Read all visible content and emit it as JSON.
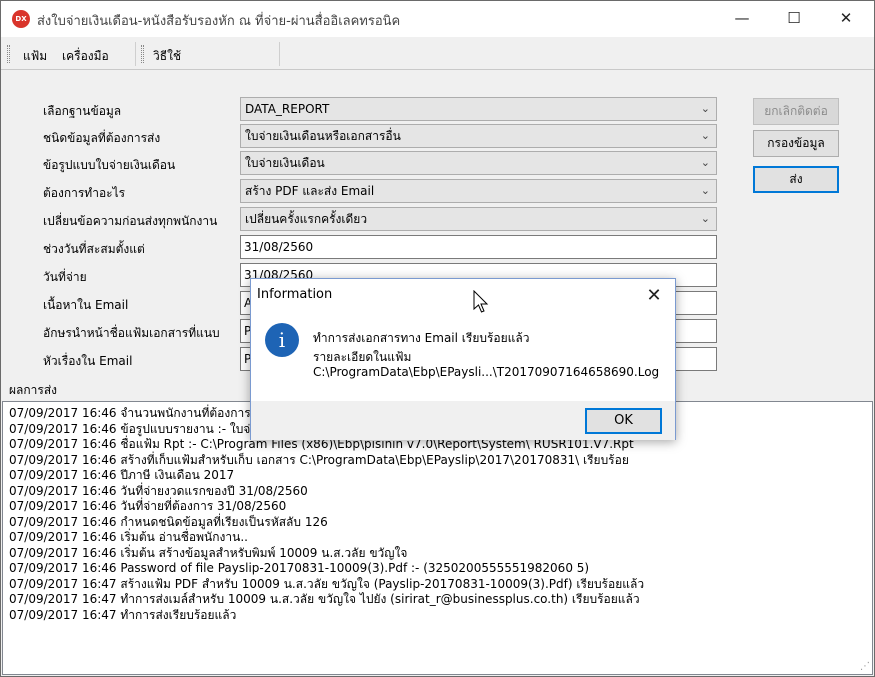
{
  "window": {
    "title": "ส่งใบจ่ายเงินเดือน-หนังสือรับรองหัก ณ ที่จ่าย-ผ่านสื่ออิเลคทรอนิค",
    "app_icon_text": "DX"
  },
  "menu": {
    "items": [
      "แฟ้ม",
      "เครื่องมือ",
      "วิธีใช้"
    ]
  },
  "form": {
    "db_label": "เลือกฐานข้อมูล",
    "db_value": "DATA_REPORT",
    "doctype_label": "ชนิดข้อมูลที่ต้องการส่ง",
    "doctype_value": "ใบจ่ายเงินเดือนหรือเอกสารอื่น",
    "format_label": "ข้อรูปแบบใบจ่ายเงินเดือน",
    "format_value": "ใบจ่ายเงินเดือน",
    "action_label": "ต้องการทำอะไร",
    "action_value": "สร้าง PDF และส่ง Email",
    "change_msg_label": "เปลี่ยนข้อความก่อนส่งทุกพนักงาน",
    "change_msg_value": "เปลี่ยนครั้งแรกครั้งเดียว",
    "period_label": "ช่วงวันที่สะสมตั้งแต่",
    "period_value": "31/08/2560",
    "paydate_label": "วันที่จ่าย",
    "paydate_value": "31/08/2560",
    "email_body_label": "เนื้อหาใน Email",
    "email_body_value": "A",
    "prefix_label": "อักษรนำหน้าชื่อแฟ้มเอกสารที่แนบ",
    "prefix_value": "P",
    "subject_label": "หัวเรื่องใน Email",
    "subject_value": "P"
  },
  "buttons": {
    "cancel_resume": "ยกเลิกติดต่อ",
    "filter": "กรองข้อมูล",
    "send": "ส่ง"
  },
  "log": {
    "label": "ผลการส่ง",
    "lines": [
      "07/09/2017 16:46 จำนวนพนักงานที่ต้องการ",
      "07/09/2017 16:46 ข้อรูปแบบรายงาน :- ใบจ่",
      "07/09/2017 16:46 ชื่อแฟ้ม Rpt :- C:\\Program Files (x86)\\Ebp\\pisinin v7.0\\Report\\System\\ RUSR101.V7.Rpt",
      "07/09/2017 16:46 สร้างที่เก็บแฟ้มสำหรับเก็บ เอกสาร C:\\ProgramData\\Ebp\\EPayslip\\2017\\20170831\\ เรียบร้อย",
      "07/09/2017 16:46 ปีภาษี เงินเดือน 2017",
      "07/09/2017 16:46 วันที่จ่ายงวดแรกของปี 31/08/2560",
      "07/09/2017 16:46 วันที่จ่ายที่ต้องการ 31/08/2560",
      "07/09/2017 16:46 กำหนดชนิดข้อมูลที่เรียงเป็นรหัสลับ 126",
      "07/09/2017 16:46 เริ่มต้น อ่านชื่อพนักงาน..",
      "07/09/2017 16:46 เริ่มต้น สร้างข้อมูลสำหรับพิมพ์ 10009 น.ส.วลัย ขวัญใจ",
      "07/09/2017 16:46 Password of file Payslip-20170831-10009(3).Pdf :- (3250200555551982060 5)",
      "07/09/2017 16:47 สร้างแฟ้ม PDF สำหรับ 10009 น.ส.วลัย ขวัญใจ (Payslip-20170831-10009(3).Pdf) เรียบร้อยแล้ว",
      "07/09/2017 16:47 ทำการส่งเมล์สำหรับ 10009 น.ส.วลัย ขวัญใจ ไปยัง (sirirat_r@businessplus.co.th) เรียบร้อยแล้ว",
      "07/09/2017 16:47 ทำการส่งเรียบร้อยแล้ว"
    ]
  },
  "dialog": {
    "title": "Information",
    "line1": "ทำการส่งเอกสารทาง Email เรียบร้อยแล้ว",
    "line2": "รายละเอียดในแฟ้ม",
    "line3": "C:\\ProgramData\\Ebp\\EPaysli...\\T20170907164658690.Log",
    "ok_label": "OK",
    "icon": "info-icon"
  },
  "colors": {
    "accent": "#0078d7",
    "info_icon": "#1e64b5",
    "app_icon": "#d9342b"
  }
}
